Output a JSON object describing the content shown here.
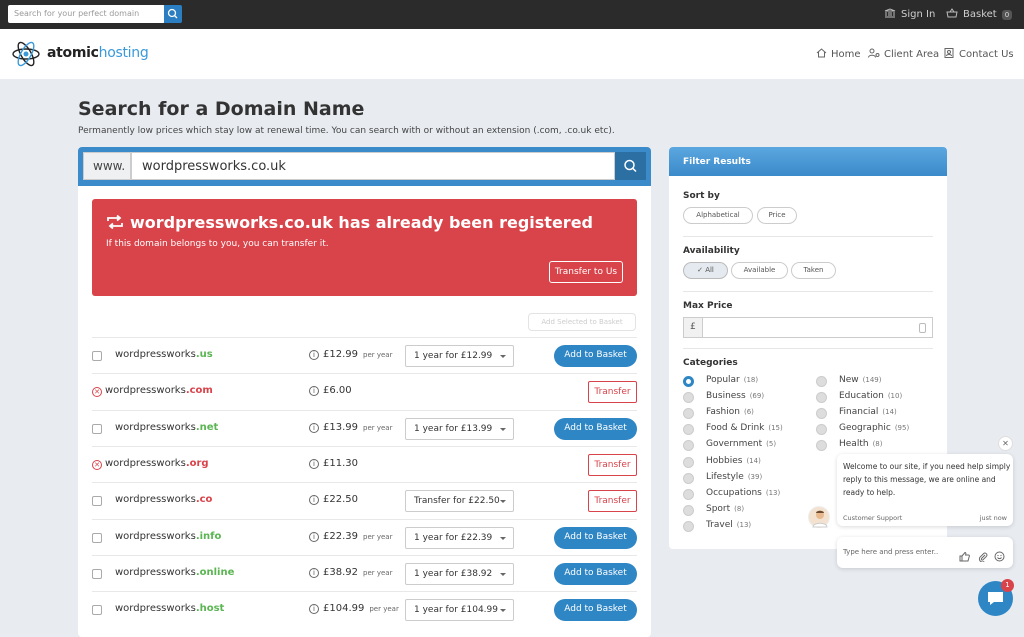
{
  "topbar": {
    "search_placeholder": "Search for your perfect domain",
    "sign_in": "Sign In",
    "basket": "Basket",
    "basket_count": "0"
  },
  "header": {
    "logo_bold": "atomic",
    "logo_light": "hosting",
    "nav": [
      "Home",
      "Client Area",
      "Contact Us"
    ]
  },
  "page": {
    "title": "Search for a Domain Name",
    "subtitle": "Permanently low prices which stay low at renewal time. You can search with or without an extension (.com, .co.uk etc)."
  },
  "search": {
    "prefix": "www.",
    "value": "wordpressworks.co.uk"
  },
  "alert": {
    "title": "wordpressworks.co.uk has already been registered",
    "subtitle": "If this domain belongs to you, you can transfer it.",
    "button": "Transfer to Us"
  },
  "results": {
    "add_selected": "Add Selected to Basket",
    "per_year": "per year",
    "rows": [
      {
        "name": "wordpressworks",
        "tld": ".us",
        "available": true,
        "price": "£12.99",
        "per_year": true,
        "period": "1 year for £12.99",
        "action": "Add to Basket"
      },
      {
        "name": "wordpressworks",
        "tld": ".com",
        "available": false,
        "price": "£6.00",
        "per_year": false,
        "period": "",
        "action": "Transfer"
      },
      {
        "name": "wordpressworks",
        "tld": ".net",
        "available": true,
        "price": "£13.99",
        "per_year": true,
        "period": "1 year for £13.99",
        "action": "Add to Basket"
      },
      {
        "name": "wordpressworks",
        "tld": ".org",
        "available": false,
        "price": "£11.30",
        "per_year": false,
        "period": "",
        "action": "Transfer"
      },
      {
        "name": "wordpressworks",
        "tld": ".co",
        "available": true,
        "taken": true,
        "price": "£22.50",
        "per_year": false,
        "period": "Transfer for £22.50",
        "action": "Transfer"
      },
      {
        "name": "wordpressworks",
        "tld": ".info",
        "available": true,
        "price": "£22.39",
        "per_year": true,
        "period": "1 year for £22.39",
        "action": "Add to Basket"
      },
      {
        "name": "wordpressworks",
        "tld": ".online",
        "available": true,
        "price": "£38.92",
        "per_year": true,
        "period": "1 year for £38.92",
        "action": "Add to Basket"
      },
      {
        "name": "wordpressworks",
        "tld": ".host",
        "available": true,
        "price": "£104.99",
        "per_year": true,
        "period": "1 year for £104.99",
        "action": "Add to Basket"
      }
    ]
  },
  "filter": {
    "title": "Filter Results",
    "sort_by": "Sort by",
    "sort_options": [
      "Alphabetical",
      "Price"
    ],
    "availability": "Availability",
    "availability_options": [
      "All",
      "Available",
      "Taken"
    ],
    "max_price": "Max Price",
    "currency": "£",
    "categories_label": "Categories",
    "categories_left": [
      {
        "label": "Popular",
        "count": "(18)",
        "selected": true
      },
      {
        "label": "Business",
        "count": "(69)"
      },
      {
        "label": "Fashion",
        "count": "(6)"
      },
      {
        "label": "Food & Drink",
        "count": "(15)"
      },
      {
        "label": "Government",
        "count": "(5)"
      },
      {
        "label": "Hobbies",
        "count": "(14)"
      },
      {
        "label": "Lifestyle",
        "count": "(39)"
      },
      {
        "label": "Occupations",
        "count": "(13)"
      },
      {
        "label": "Sport",
        "count": "(8)"
      },
      {
        "label": "Travel",
        "count": "(13)"
      }
    ],
    "categories_right": [
      {
        "label": "New",
        "count": "(149)"
      },
      {
        "label": "Education",
        "count": "(10)"
      },
      {
        "label": "Financial",
        "count": "(14)"
      },
      {
        "label": "Geographic",
        "count": "(95)"
      },
      {
        "label": "Health",
        "count": "(8)"
      }
    ]
  },
  "chat": {
    "message": "Welcome to our site, if you need help simply reply to this message, we are online and ready to help.",
    "sender": "Customer Support",
    "time": "just now",
    "placeholder": "Type here and press enter..",
    "badge": "1"
  },
  "colors": {
    "accent": "#2f86c4",
    "danger": "#d9434a",
    "success": "#5ab552",
    "topbar": "#2b2b2b"
  }
}
